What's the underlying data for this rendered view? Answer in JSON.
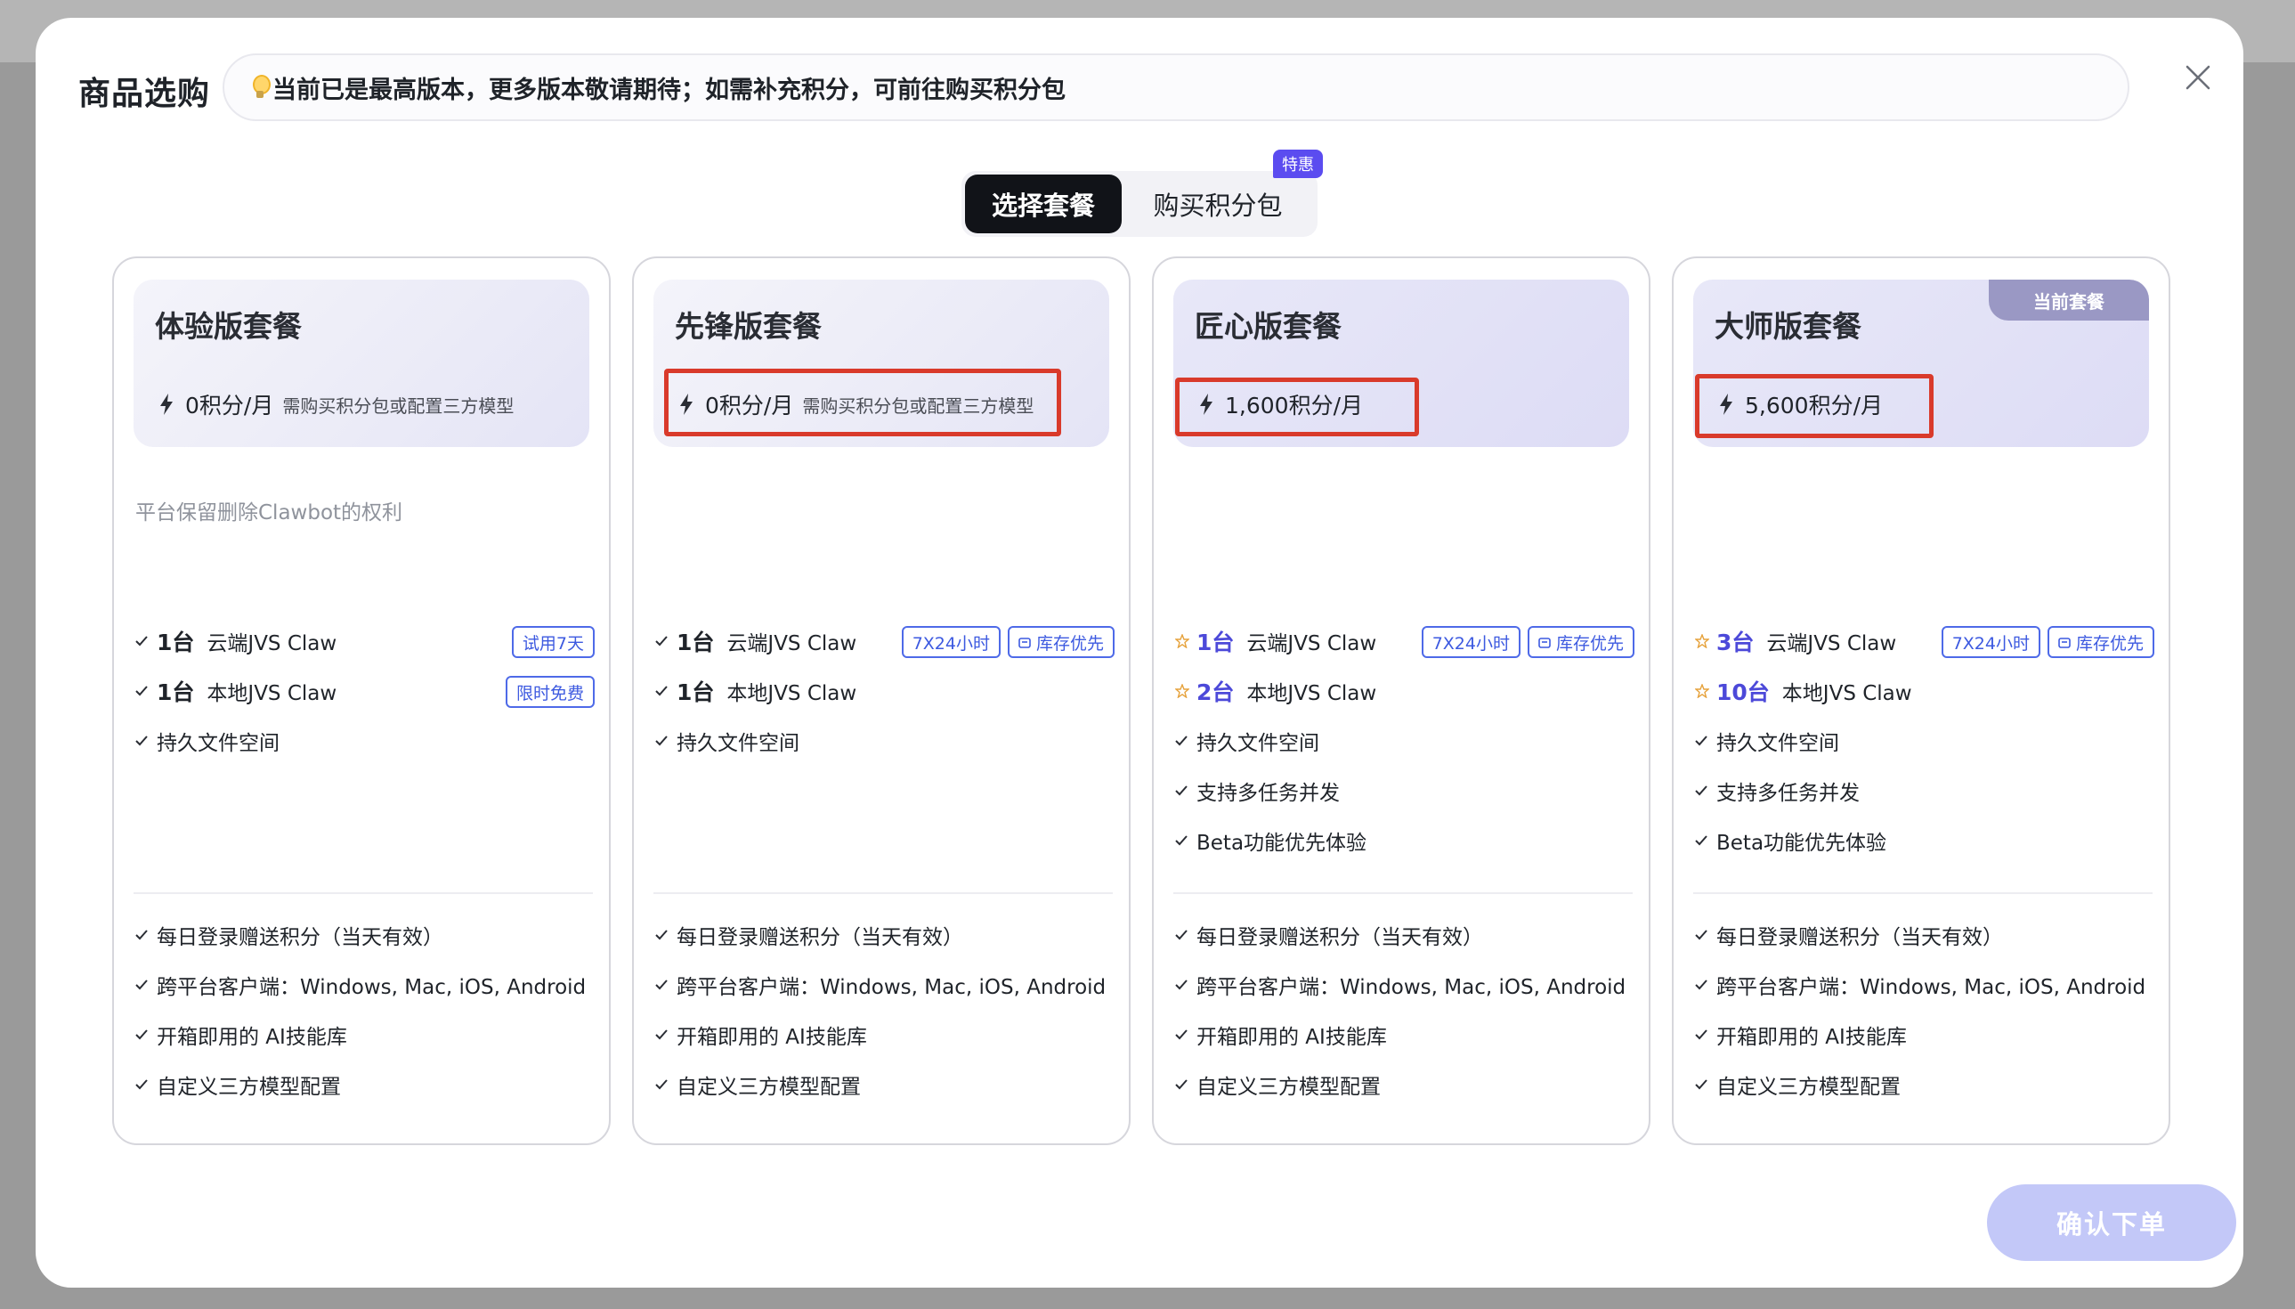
{
  "modal": {
    "title": "商品选购",
    "notice": "当前已是最高版本，更多版本敬请期待；如需补充积分，可前往购买积分包",
    "close_icon": "close-icon"
  },
  "tabs": [
    {
      "label": "选择套餐",
      "active": true
    },
    {
      "label": "购买积分包",
      "active": false,
      "badge": "特惠"
    }
  ],
  "cards": [
    {
      "title": "体验版套餐",
      "price": "0积分/月",
      "price_note": "需购买积分包或配置三方模型",
      "disclaimer": "平台保留删除Clawbot的权利",
      "features": [
        {
          "qty": "1台",
          "text": "云端JVS Claw",
          "tags": [
            "试用7天"
          ]
        },
        {
          "qty": "1台",
          "text": "本地JVS Claw",
          "tags": [
            "限时免费"
          ]
        },
        {
          "qty": "",
          "text": "持久文件空间",
          "tags": []
        }
      ],
      "common": [
        "每日登录赠送积分（当天有效）",
        "跨平台客户端：Windows, Mac, iOS, Android",
        "开箱即用的 AI技能库",
        "自定义三方模型配置"
      ]
    },
    {
      "title": "先锋版套餐",
      "price": "0积分/月",
      "price_note": "需购买积分包或配置三方模型",
      "disclaimer": "",
      "features": [
        {
          "qty": "1台",
          "text": "云端JVS Claw",
          "tags": [
            "7X24小时",
            "库存优先"
          ]
        },
        {
          "qty": "1台",
          "text": "本地JVS Claw",
          "tags": []
        },
        {
          "qty": "",
          "text": "持久文件空间",
          "tags": []
        }
      ],
      "common": [
        "每日登录赠送积分（当天有效）",
        "跨平台客户端：Windows, Mac, iOS, Android",
        "开箱即用的 AI技能库",
        "自定义三方模型配置"
      ]
    },
    {
      "title": "匠心版套餐",
      "price": "1,600积分/月",
      "price_note": "",
      "disclaimer": "",
      "features": [
        {
          "qty": "1台",
          "text": "云端JVS Claw",
          "tags": [
            "7X24小时",
            "库存优先"
          ],
          "star": true
        },
        {
          "qty": "2台",
          "text": "本地JVS Claw",
          "tags": [],
          "star": true
        },
        {
          "qty": "",
          "text": "持久文件空间",
          "tags": []
        },
        {
          "qty": "",
          "text": "支持多任务并发",
          "tags": []
        },
        {
          "qty": "",
          "text": "Beta功能优先体验",
          "tags": []
        }
      ],
      "common": [
        "每日登录赠送积分（当天有效）",
        "跨平台客户端：Windows, Mac, iOS, Android",
        "开箱即用的 AI技能库",
        "自定义三方模型配置"
      ]
    },
    {
      "title": "大师版套餐",
      "price": "5,600积分/月",
      "price_note": "",
      "disclaimer": "",
      "current_tag": "当前套餐",
      "features": [
        {
          "qty": "3台",
          "text": "云端JVS Claw",
          "tags": [
            "7X24小时",
            "库存优先"
          ],
          "star": true
        },
        {
          "qty": "10台",
          "text": "本地JVS Claw",
          "tags": [],
          "star": true
        },
        {
          "qty": "",
          "text": "持久文件空间",
          "tags": []
        },
        {
          "qty": "",
          "text": "支持多任务并发",
          "tags": []
        },
        {
          "qty": "",
          "text": "Beta功能优先体验",
          "tags": []
        }
      ],
      "common": [
        "每日登录赠送积分（当天有效）",
        "跨平台客户端：Windows, Mac, iOS, Android",
        "开箱即用的 AI技能库",
        "自定义三方模型配置"
      ]
    }
  ],
  "confirm_label": "确认下单",
  "colors": {
    "accent": "#4c49d9",
    "highlight": "#d93a2b",
    "tag_border": "#4e6ae8",
    "confirm_bg": "#c3c8f8",
    "promo_badge": "#5b4cf0"
  }
}
